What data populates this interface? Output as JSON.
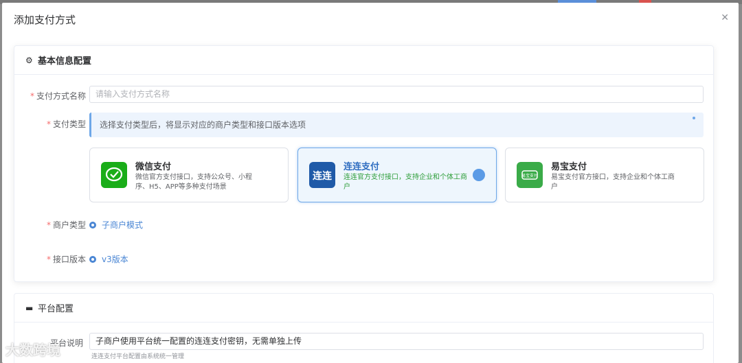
{
  "dialog": {
    "title": "添加支付方式",
    "close_icon": "close-icon"
  },
  "basic": {
    "title": "基本信息配置",
    "icon": "gear-icon",
    "name_label": "支付方式名称",
    "name_placeholder": "请输入支付方式名称",
    "type_label": "支付类型",
    "alert_text": "选择支付类型后，将显示对应的商户类型和接口版本选项",
    "methods": [
      {
        "name": "微信支付",
        "desc": "微信官方支付接口，支持公众号、小程序、H5、APP等多种支付场景",
        "logo": "wechat-pay-logo",
        "color": "#1aad19"
      },
      {
        "name": "连连支付",
        "desc": "连连官方支付接口，支持企业和个体工商户",
        "logo": "lianlian-pay-logo",
        "color": "#1f5aa8"
      },
      {
        "name": "易宝支付",
        "desc": "易宝支付官方接口，支持企业和个体工商户",
        "logo": "yeepay-logo",
        "color": "#3aab48"
      }
    ],
    "merchant_label": "商户类型",
    "merchant_value": "子商户模式",
    "version_label": "接口版本",
    "version_value": "v3版本"
  },
  "platform": {
    "title": "平台配置",
    "icon": "monitor-icon",
    "desc_label": "平台说明",
    "desc_value": "子商户使用平台统一配置的连连支付密钥，无需单独上传",
    "hint": "连连支付平台配置由系统统一管理"
  },
  "watermark": "大数跨境",
  "colors": {
    "accent": "#4a86d4",
    "required": "#f56c6c"
  }
}
